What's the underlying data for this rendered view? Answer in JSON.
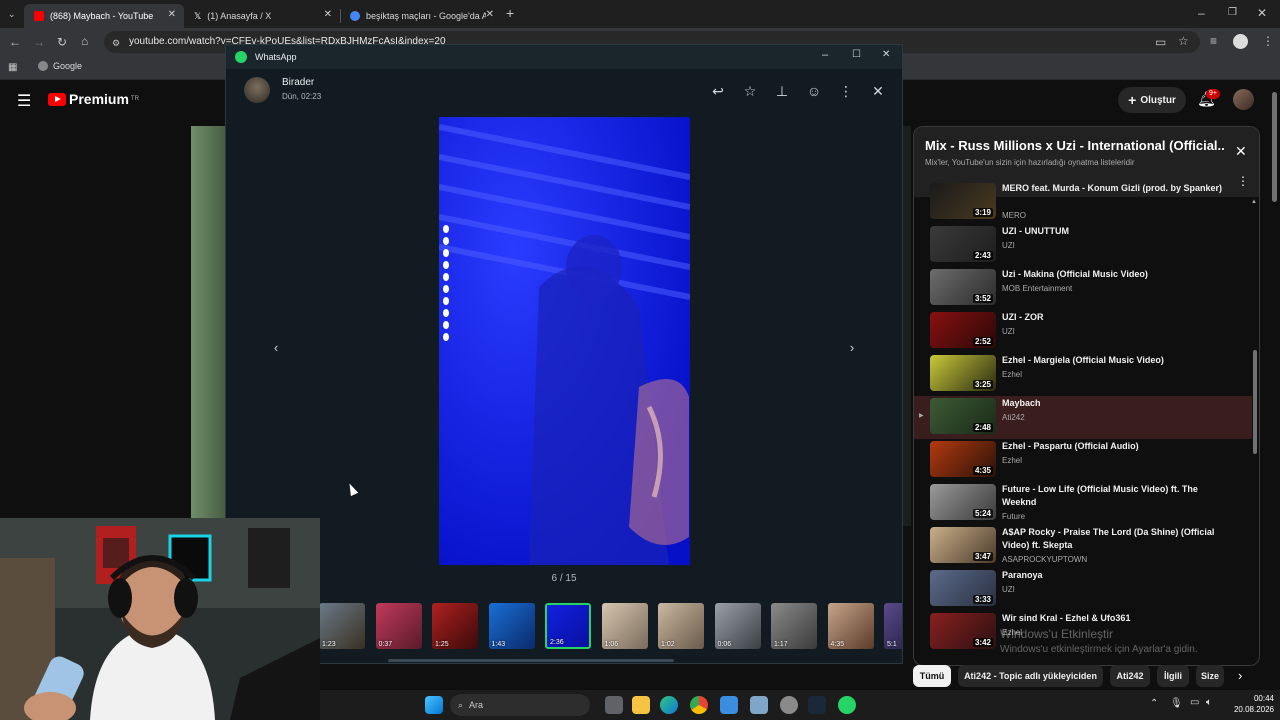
{
  "browser": {
    "tabs": [
      {
        "title": "(868) Maybach - YouTube",
        "color": "#ff0000"
      },
      {
        "title": "(1) Anasayfa / X",
        "color": "#ffffff"
      },
      {
        "title": "beşiktaş maçları - Google'da Ar",
        "color": "#4285f4"
      }
    ],
    "url": "youtube.com/watch?v=CFEv-kPoUEs&list=RDxBJHMzFcAsI&index=20",
    "bookmark": "Google"
  },
  "youtube": {
    "logo": "Premium",
    "logo_region": "TR",
    "create_label": "Oluştur",
    "notif_count": "9+",
    "playlist": {
      "title": "Mix - Russ Millions x Uzi - International (Official...",
      "subtitle": "Mix'ler, YouTube'un sizin için hazırladığı oynatma listeleridir",
      "items": [
        {
          "title": "MERO feat. Murda - Konum Gizli (prod. by Spanker)",
          "channel": "MERO",
          "duration": "3:19"
        },
        {
          "title": "UZI - UNUTTUM",
          "channel": "UZI",
          "duration": "2:43"
        },
        {
          "title": "Uzi - Makina (Official Music Video)",
          "channel": "MOB Entertainment",
          "duration": "3:52"
        },
        {
          "title": "UZI - ZOR",
          "channel": "UZI",
          "duration": "2:52"
        },
        {
          "title": "Ezhel - Margiela (Official Music Video)",
          "channel": "Ezhel",
          "duration": "3:25"
        },
        {
          "title": "Maybach",
          "channel": "Ati242",
          "duration": "2:48"
        },
        {
          "title": "Ezhel - Paspartu (Official Audio)",
          "channel": "Ezhel",
          "duration": "4:35"
        },
        {
          "title": "Future - Low Life (Official Music Video) ft. The Weeknd",
          "channel": "Future",
          "duration": "5:24"
        },
        {
          "title": "A$AP Rocky - Praise The Lord (Da Shine) (Official Video) ft. Skepta",
          "channel": "ASAPROCKYUPTOWN",
          "duration": "3:47"
        },
        {
          "title": "Paranoya",
          "channel": "UZI",
          "duration": "3:33"
        },
        {
          "title": "Wir sind Kral - Ezhel & Ufo361",
          "channel": "Ezhel",
          "duration": "3:42"
        }
      ]
    },
    "chips": [
      "Tümü",
      "Ati242 - Topic adlı yükleyiciden",
      "Ati242",
      "İlgili",
      "Size"
    ]
  },
  "whatsapp": {
    "app_title": "WhatsApp",
    "contact": "Birader",
    "timestamp": "Dün, 02:23",
    "counter": "6 / 15",
    "thumbs": [
      "1:23",
      "0:37",
      "1:25",
      "1:43",
      "2:36",
      "1:06",
      "1:02",
      "0:06",
      "1:17",
      "4:35",
      "5:1"
    ]
  },
  "windows": {
    "activation_line1": "Windows'u Etkinleştir",
    "activation_line2": "Windows'u etkinleştirmek için Ayarlar'a gidin.",
    "search_placeholder": "Ara",
    "time": "00:44",
    "date": "20.08.2026"
  },
  "colors": {
    "whatsapp_green": "#25d366",
    "youtube_red": "#ff0000",
    "media_blue": "#0d1cff"
  }
}
